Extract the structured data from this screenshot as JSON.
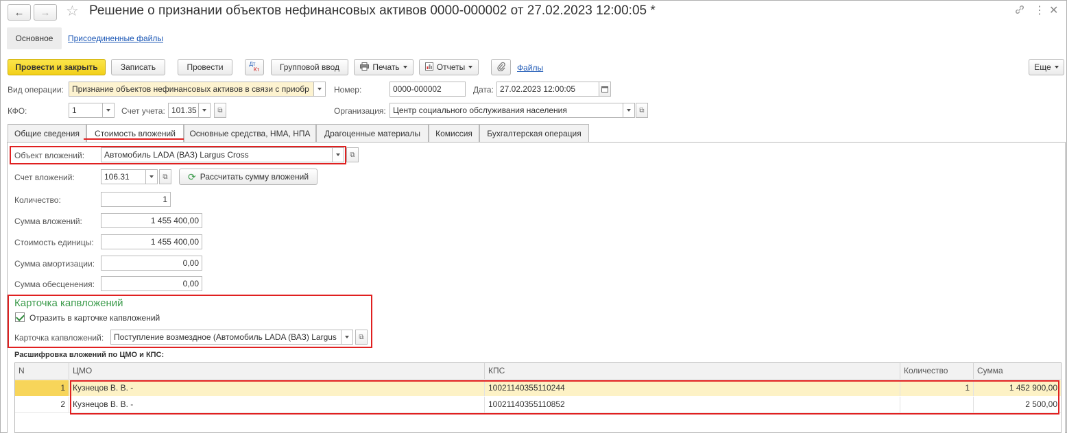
{
  "window": {
    "title": "Решение о признании объектов нефинансовых активов 0000-000002 от 27.02.2023 12:00:05 *",
    "back_icon": "arrow-left-icon",
    "forward_icon": "arrow-right-icon",
    "favorite_icon": "star-icon",
    "link_icon": "link-icon",
    "menu_icon": "more-vertical-icon",
    "close_icon": "close-icon"
  },
  "subnav": {
    "main": "Основное",
    "attached": "Присоединенные файлы"
  },
  "toolbar": {
    "post_close": "Провести и закрыть",
    "save": "Записать",
    "post": "Провести",
    "dtkt_top": "Дт",
    "dtkt_bottom": "Кт",
    "group_input": "Групповой ввод",
    "print": "Печать",
    "reports": "Отчеты",
    "files": "Файлы",
    "more": "Еще"
  },
  "header": {
    "op_type_label": "Вид операции:",
    "op_type_value": "Признание объектов нефинансовых активов в связи с приобр",
    "number_label": "Номер:",
    "number_value": "0000-000002",
    "date_label": "Дата:",
    "date_value": "27.02.2023 12:00:05",
    "kfo_label": "КФО:",
    "kfo_value": "1",
    "account_label": "Счет учета:",
    "account_value": "101.35",
    "org_label": "Организация:",
    "org_value": "Центр социального обслуживания населения"
  },
  "tabs": [
    "Общие сведения",
    "Стоимость вложений",
    "Основные средства, НМА, НПА",
    "Драгоценные материалы",
    "Комиссия",
    "Бухгалтерская операция"
  ],
  "form": {
    "object_label": "Объект вложений:",
    "object_value": "Автомобиль LADA (ВАЗ) Largus Cross",
    "invest_account_label": "Счет вложений:",
    "invest_account_value": "106.31",
    "calc_button": "Рассчитать сумму вложений",
    "qty_label": "Количество:",
    "qty_value": "1",
    "sum_label": "Сумма вложений:",
    "sum_value": "1 455 400,00",
    "unit_cost_label": "Стоимость единицы:",
    "unit_cost_value": "1 455 400,00",
    "amort_label": "Сумма амортизации:",
    "amort_value": "0,00",
    "impair_label": "Сумма обесценения:",
    "impair_value": "0,00"
  },
  "capcard": {
    "title": "Карточка капвложений",
    "checkbox_label": "Отразить в карточке капвложений",
    "checked": true,
    "card_label": "Карточка капвложений:",
    "card_value": "Поступление возмездное (Автомобиль LADA (ВАЗ) Largus"
  },
  "table": {
    "title": "Расшифровка вложений по ЦМО и КПС:",
    "columns": [
      "N",
      "ЦМО",
      "КПС",
      "Количество",
      "Сумма"
    ],
    "rows": [
      {
        "n": "1",
        "cmo": "Кузнецов В. В. -",
        "kps": "10021140355110244",
        "qty": "1",
        "sum": "1 452 900,00"
      },
      {
        "n": "2",
        "cmo": "Кузнецов В. В. -",
        "kps": "10021140355110852",
        "qty": "",
        "sum": "2 500,00"
      }
    ]
  },
  "colors": {
    "primary_button": "#f2d01a",
    "highlight_red": "#e02020",
    "group_title_green": "#3a9a4a",
    "link_blue": "#1a56b5",
    "selected_row": "#fdf2c6"
  }
}
